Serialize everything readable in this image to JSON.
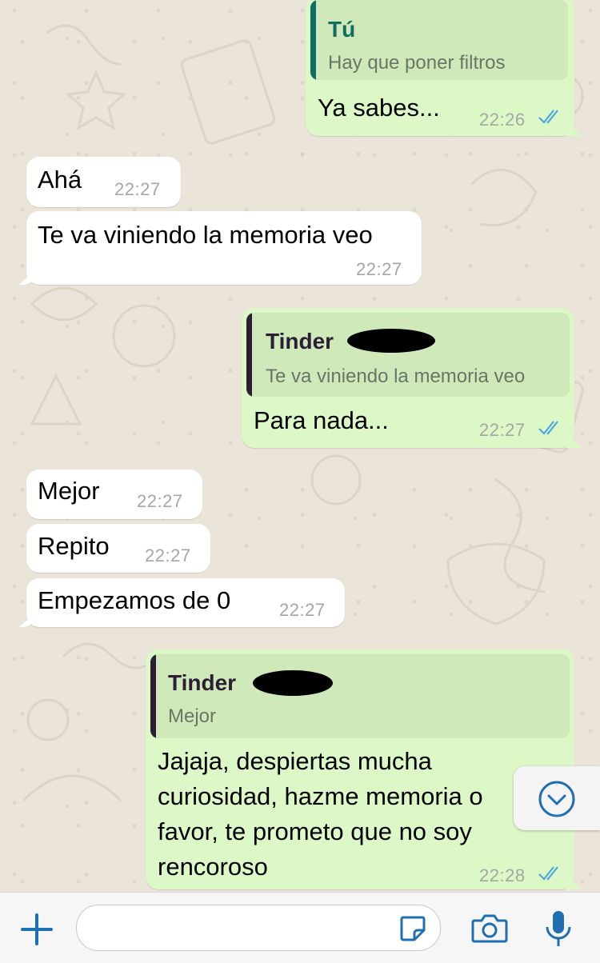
{
  "messages": [
    {
      "id": "m1",
      "direction": "outgoing",
      "quote": {
        "author": "Tú",
        "text": "Hay que poner filtros"
      },
      "text": "Ya sabes...",
      "time": "22:26",
      "status": "read"
    },
    {
      "id": "m2",
      "direction": "incoming",
      "text": "Ahá",
      "time": "22:27"
    },
    {
      "id": "m3",
      "direction": "incoming",
      "text": "Te va viniendo la memoria veo",
      "time": "22:27"
    },
    {
      "id": "m4",
      "direction": "outgoing",
      "quote": {
        "author": "Tinder",
        "text": "Te va viniendo la memoria veo"
      },
      "text": "Para nada...",
      "time": "22:27",
      "status": "read"
    },
    {
      "id": "m5",
      "direction": "incoming",
      "text": "Mejor",
      "time": "22:27"
    },
    {
      "id": "m6",
      "direction": "incoming",
      "text": "Repito",
      "time": "22:27"
    },
    {
      "id": "m7",
      "direction": "incoming",
      "text": "Empezamos de 0",
      "time": "22:27"
    },
    {
      "id": "m8",
      "direction": "outgoing",
      "quote": {
        "author": "Tinder",
        "text": "Mejor"
      },
      "text": "Jajaja, despiertas mucha curiosidad, hazme memoria o favor, te prometo que no soy rencoroso",
      "time": "22:28",
      "status": "read"
    }
  ],
  "composer": {
    "placeholder": ""
  },
  "icons": {
    "attach": "plus-icon",
    "sticker": "sticker-icon",
    "camera": "camera-icon",
    "mic": "microphone-icon",
    "scroll": "chevron-down-circle-icon",
    "read": "double-check-icon"
  },
  "colors": {
    "accent": "#1f6fb2",
    "outgoing_bubble": "#dcf8c6",
    "incoming_bubble": "#ffffff",
    "quote_self": "#0f6e62",
    "quote_other": "#2c1f33",
    "read_ticks": "#4fa6e0"
  }
}
